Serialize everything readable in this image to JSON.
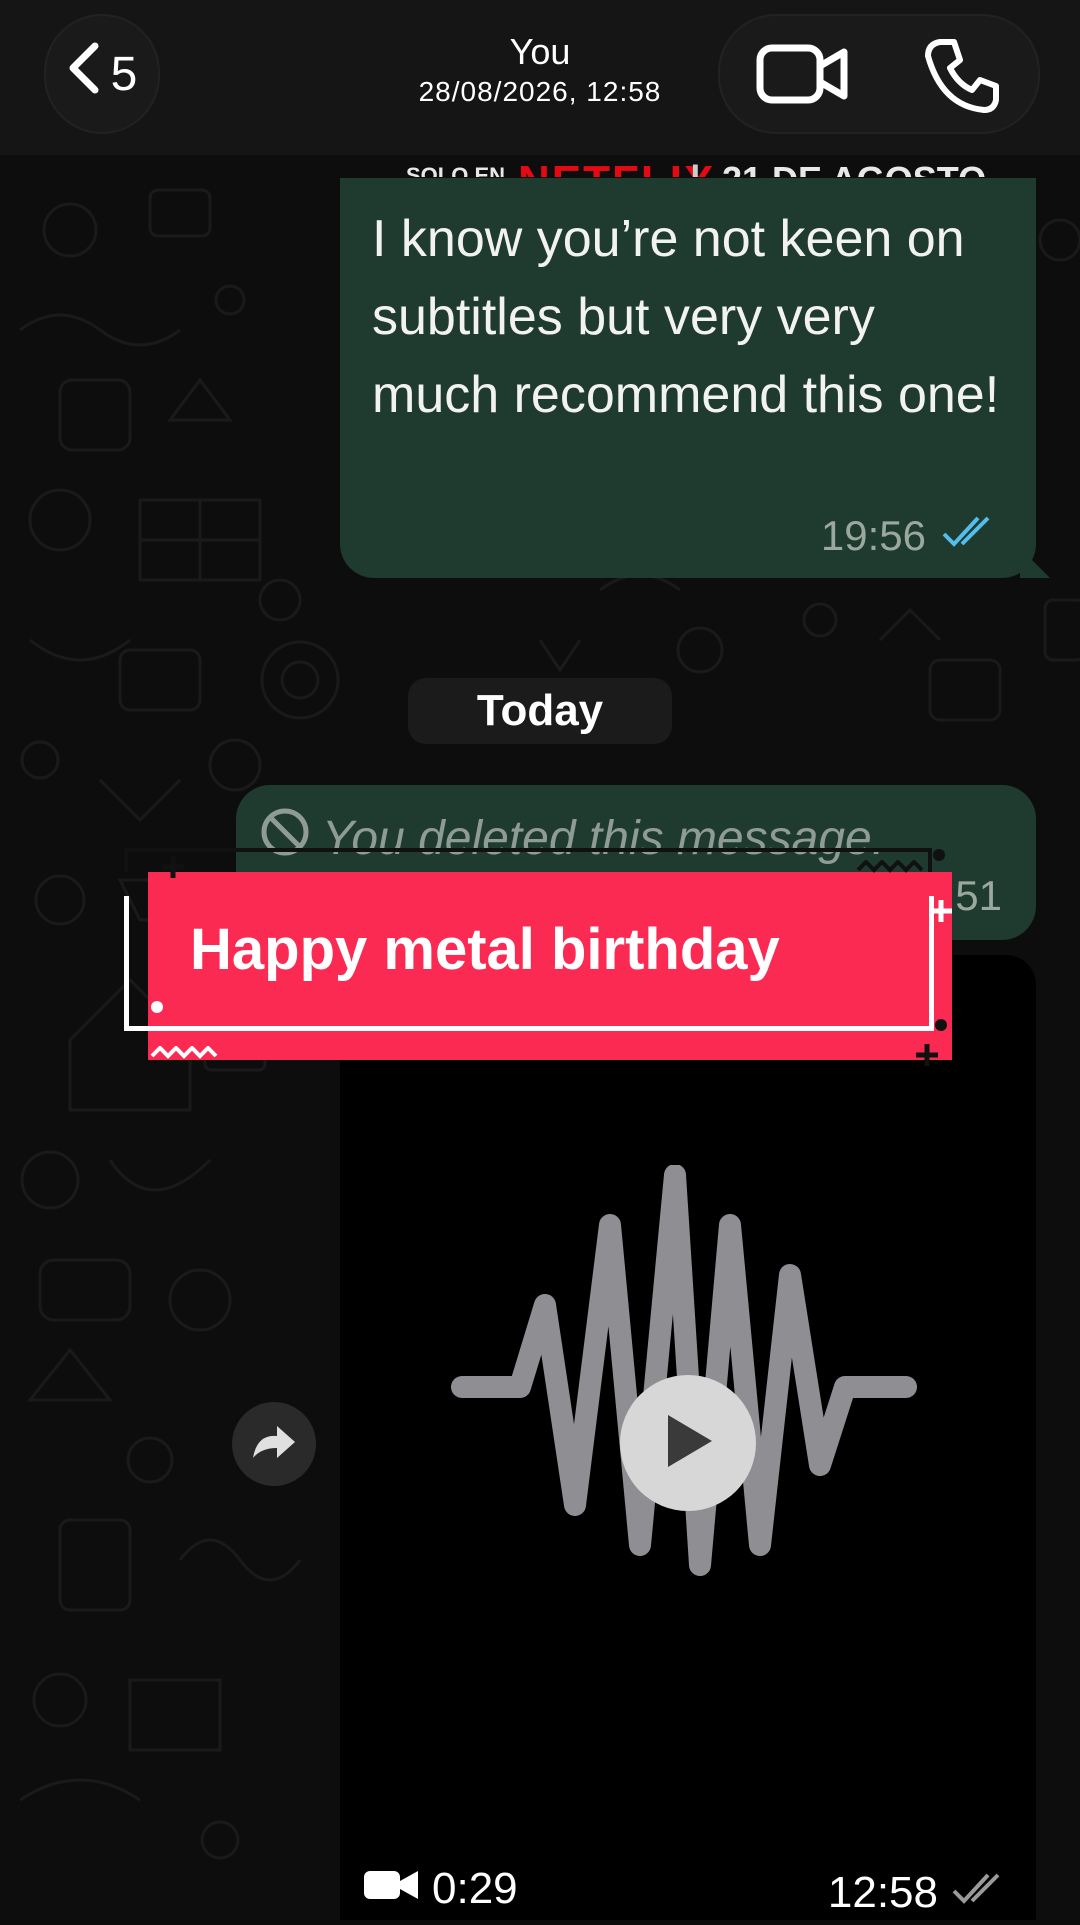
{
  "header": {
    "back_count": "5",
    "contact_name": "You",
    "subtitle": "28/08/2026, 12:58"
  },
  "banner": {
    "solo": "SOLO EN",
    "netflix": "NETFLIX",
    "separator": "|",
    "date": "21 DE AGOSTO"
  },
  "messages": {
    "outgoing_text": "I know you’re not keen on subtitles but very very much recommend this one!",
    "outgoing_time": "19:56",
    "date_divider": "Today",
    "deleted_text": "You deleted this message.",
    "deleted_time": "12:51",
    "video_duration": "0:29",
    "video_time": "12:58"
  },
  "sticker": {
    "text": "Happy metal birthday"
  },
  "colors": {
    "bubble_out": "#1f3a2e",
    "read_tick": "#53bdeb",
    "sticker_pink": "#fb2a52",
    "netflix_red": "#e50914"
  },
  "icons": {
    "back": "chevron-left-icon",
    "video_call": "video-camera-icon",
    "phone_call": "phone-icon",
    "deleted": "prohibited-icon",
    "play": "play-icon",
    "forward": "forward-icon",
    "read": "double-check-icon"
  }
}
